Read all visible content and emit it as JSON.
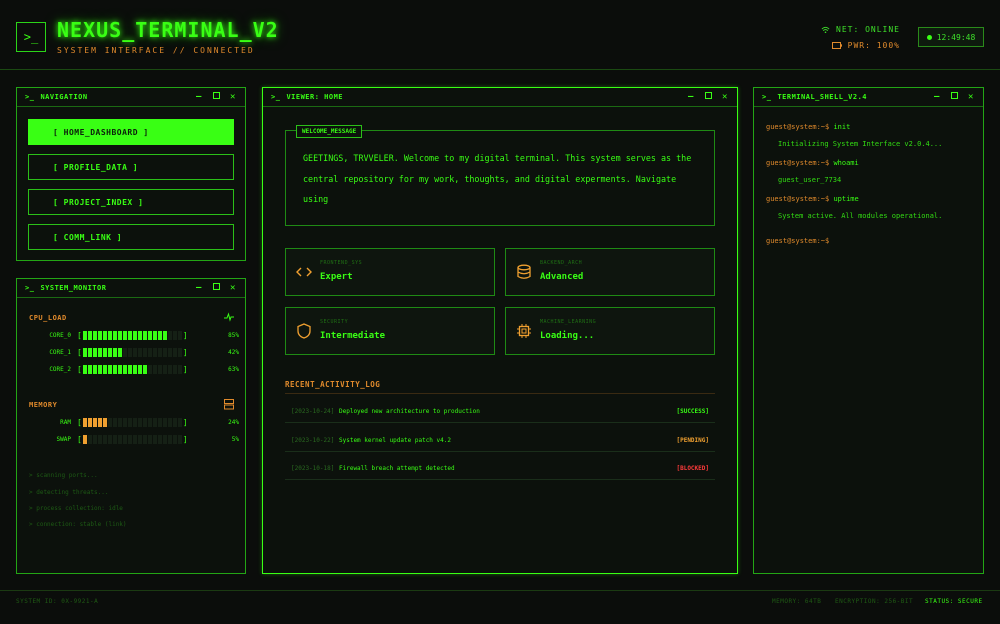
{
  "header": {
    "logo": ">_",
    "title": "NEXUS_TERMINAL_V2",
    "subtitle": "SYSTEM INTERFACE // CONNECTED",
    "net": "NET: ONLINE",
    "pwr": "PWR: 100%",
    "clock": "12:49:48"
  },
  "nav_window": {
    "title": "NAVIGATION",
    "items": [
      {
        "label": "[ HOME_DASHBOARD ]"
      },
      {
        "label": "[ PROFILE_DATA ]"
      },
      {
        "label": "[ PROJECT_INDEX ]"
      },
      {
        "label": "[ COMM_LINK ]"
      }
    ]
  },
  "monitor_window": {
    "title": "SYSTEM_MONITOR",
    "cpu_label": "CPU_LOAD",
    "memory_label": "MEMORY",
    "cpu": [
      {
        "name": "CORE_0",
        "pct_text": "85%",
        "value": 0.85
      },
      {
        "name": "CORE_1",
        "pct_text": "42%",
        "value": 0.42
      },
      {
        "name": "CORE_2",
        "pct_text": "63%",
        "value": 0.63
      }
    ],
    "memory": [
      {
        "name": "RAM",
        "pct_text": "24%",
        "value": 0.24
      },
      {
        "name": "SWAP",
        "pct_text": "5%",
        "value": 0.05
      }
    ],
    "logs": [
      "> scanning ports...",
      "> detecting threats...",
      "> process collection: idle",
      "> connection: stable (link)"
    ]
  },
  "viewer_window": {
    "title": "VIEWER: HOME",
    "welcome_tag": "WELCOME_MESSAGE",
    "welcome_text": "GEETINGS, TRVVELER. Welcome to my digital terminal. This system serves as the central repository for my work, thoughts, and digital experments. Navigate using",
    "cards": [
      {
        "caption": "FRONTEND_SYS",
        "value": "Expert",
        "icon": "code-icon"
      },
      {
        "caption": "BACKEND_ARCH",
        "value": "Advanced",
        "icon": "database-icon"
      },
      {
        "caption": "SECURITY",
        "value": "Intermediate",
        "icon": "shield-icon"
      },
      {
        "caption": "MACHINE_LEARNING",
        "value": "Loading...",
        "icon": "chip-icon"
      }
    ],
    "activity_title": "RECENT_ACTIVITY_LOG",
    "activity": [
      {
        "date": "[2023-10-24]",
        "text": "Deployed new architecture to production",
        "status": "[SUCCESS]",
        "status_color": "#39ff14"
      },
      {
        "date": "[2023-10-22]",
        "text": "System kernel update patch v4.2",
        "status": "[PENDING]",
        "status_color": "#f0a030"
      },
      {
        "date": "[2023-10-18]",
        "text": "Firewall breach attempt detected",
        "status": "[BLOCKED]",
        "status_color": "#ff3b3b"
      }
    ]
  },
  "shell_window": {
    "title": "TERMINAL_SHELL_V2.4",
    "prompt": "guest@system:~$",
    "lines": [
      {
        "cmd": "init",
        "out": "Initializing System Interface v2.0.4..."
      },
      {
        "cmd": "whoami",
        "out": "guest_user_7734"
      },
      {
        "cmd": "uptime",
        "out": "System active. All modules operational."
      }
    ]
  },
  "footer": {
    "left": "SYSTEM ID: 0X-9921-A",
    "memory": "MEMORY: 64TB",
    "encryption": "ENCRYPTION: 256-BIT",
    "status": "STATUS: SECURE"
  }
}
